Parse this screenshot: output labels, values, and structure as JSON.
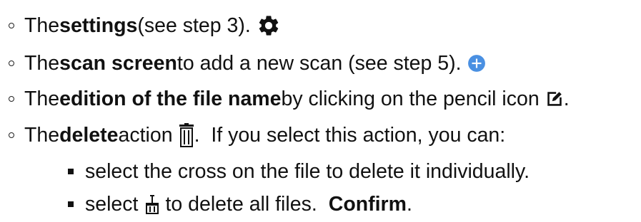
{
  "items": [
    {
      "pre": "The ",
      "bold": "settings",
      "post": " (see step 3).",
      "icon": "gear-icon"
    },
    {
      "pre": "The ",
      "bold": "scan screen",
      "post": " to add a new scan (see step 5).",
      "icon": "plus-circle-icon",
      "icon_color": "#4a90e2"
    },
    {
      "pre": "The ",
      "bold": "edition of the file name",
      "post": " by clicking on the pencil icon",
      "icon": "edit-pencil-icon",
      "end": "."
    },
    {
      "pre": "The ",
      "bold": "delete",
      "post": " action",
      "icon": "trash-icon",
      "after": ".  If you select this action, you can:",
      "subitems": [
        {
          "text": "select the cross on the file to delete it individually."
        },
        {
          "pre": "select",
          "icon": "delete-all-icon",
          "post": "to delete all files.",
          "bold": "Confirm",
          "end": "."
        }
      ]
    }
  ]
}
